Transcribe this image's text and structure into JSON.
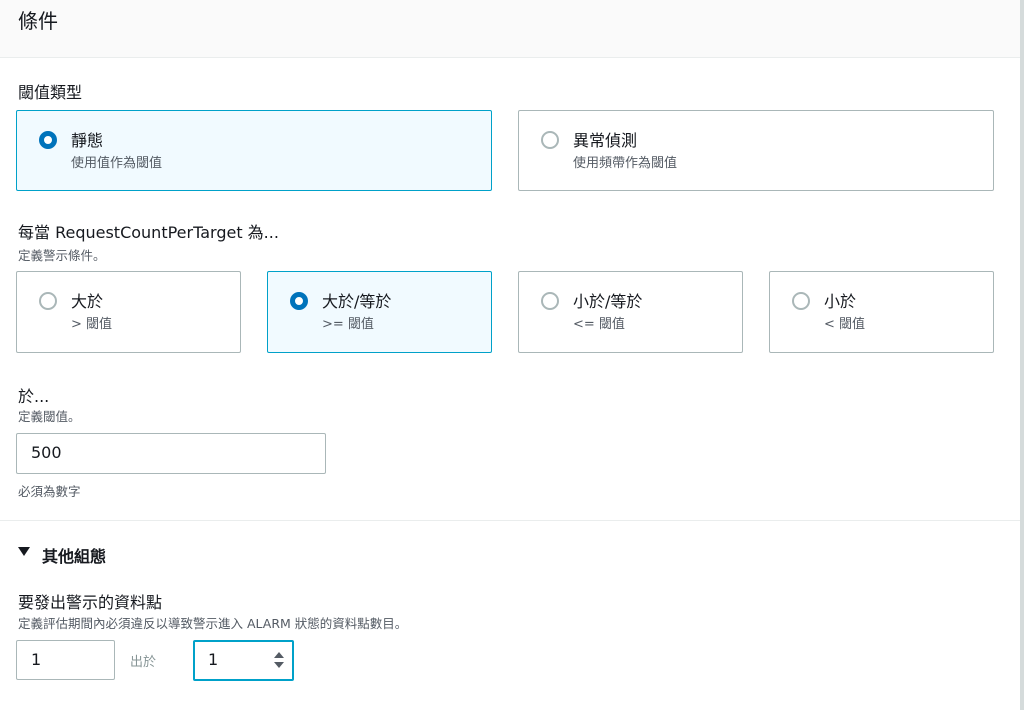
{
  "header": {
    "title": "條件"
  },
  "threshold_type": {
    "label": "閾值類型",
    "options": [
      {
        "title": "靜態",
        "subtitle": "使用值作為閾值",
        "selected": true
      },
      {
        "title": "異常偵測",
        "subtitle": "使用頻帶作為閾值",
        "selected": false
      }
    ]
  },
  "condition": {
    "label": "每當 RequestCountPerTarget 為...",
    "description": "定義警示條件。",
    "options": [
      {
        "title": "大於",
        "subtitle": "> 閾值",
        "selected": false
      },
      {
        "title": "大於/等於",
        "subtitle": ">= 閾值",
        "selected": true
      },
      {
        "title": "小於/等於",
        "subtitle": "<= 閾值",
        "selected": false
      },
      {
        "title": "小於",
        "subtitle": "< 閾值",
        "selected": false
      }
    ]
  },
  "threshold_value": {
    "label": "於...",
    "description": "定義閾值。",
    "value": "500",
    "hint": "必須為數字"
  },
  "additional_config": {
    "label": "其他組態",
    "expanded": true
  },
  "datapoints": {
    "label": "要發出警示的資料點",
    "description": "定義評估期間內必須違反以導致警示進入 ALARM 狀態的資料點數目。",
    "value_a": "1",
    "out_of_label": "出於",
    "value_b": "1"
  }
}
